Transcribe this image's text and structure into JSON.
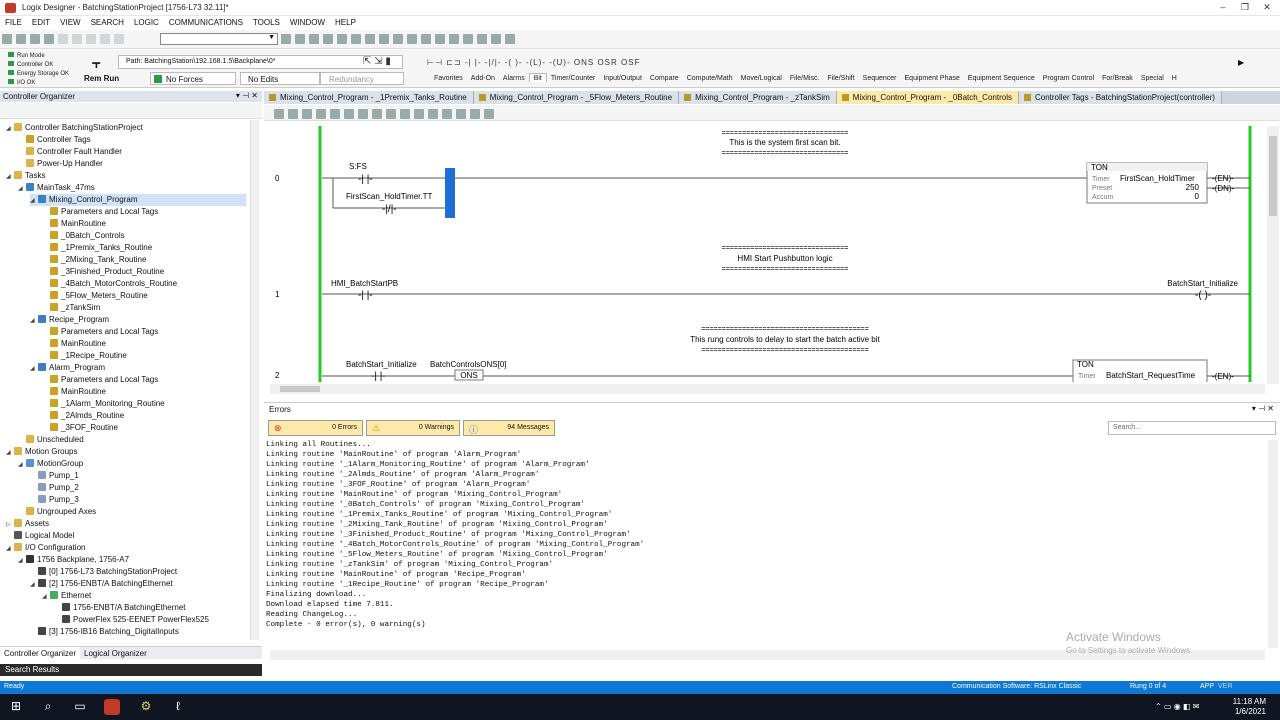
{
  "window": {
    "title": "Logix Designer - BatchingStationProject [1756-L73 32.11]*"
  },
  "menu": [
    "FILE",
    "EDIT",
    "VIEW",
    "SEARCH",
    "LOGIC",
    "COMMUNICATIONS",
    "TOOLS",
    "WINDOW",
    "HELP"
  ],
  "status": {
    "run_mode": "Run Mode",
    "controller_ok": "Controller OK",
    "energy_storage_ok": "Energy Storage OK",
    "io_ok": "I/O OK",
    "rem_run": "Rem Run",
    "no_forces": "No Forces",
    "no_edits": "No Edits",
    "redundancy": "Redundancy"
  },
  "path": {
    "label": "Path: BatchingStation\\192.168.1.5\\Backplane\\0*"
  },
  "instructions": [
    "ONS",
    "OSR",
    "OSF"
  ],
  "categories": [
    "Favorites",
    "Add-On",
    "Alarms",
    "Bit",
    "Timer/Counter",
    "Input/Output",
    "Compare",
    "Compute/Math",
    "Move/Logical",
    "File/Misc.",
    "File/Shift",
    "Sequencer",
    "Equipment Phase",
    "Equipment Sequence",
    "Program Control",
    "For/Break",
    "Special",
    "H"
  ],
  "active_category": "Bit",
  "organizer": {
    "title": "Controller Organizer",
    "tabs": [
      "Controller Organizer",
      "Logical Organizer"
    ],
    "tree": [
      {
        "label": "Controller BatchingStationProject",
        "level": 0,
        "exp": "◢",
        "icon": "folder"
      },
      {
        "label": "Controller Tags",
        "level": 1,
        "exp": "",
        "icon": "tag"
      },
      {
        "label": "Controller Fault Handler",
        "level": 1,
        "exp": "",
        "icon": "folder"
      },
      {
        "label": "Power-Up Handler",
        "level": 1,
        "exp": "",
        "icon": "folder"
      },
      {
        "label": "Tasks",
        "level": 0,
        "exp": "◢",
        "icon": "folder"
      },
      {
        "label": "MainTask_47ms",
        "level": 1,
        "exp": "◢",
        "icon": "task"
      },
      {
        "label": "Mixing_Control_Program",
        "level": 2,
        "exp": "◢",
        "icon": "program",
        "selected": true
      },
      {
        "label": "Parameters and Local Tags",
        "level": 3,
        "exp": "",
        "icon": "tag"
      },
      {
        "label": "MainRoutine",
        "level": 3,
        "exp": "",
        "icon": "routine"
      },
      {
        "label": "_0Batch_Controls",
        "level": 3,
        "exp": "",
        "icon": "routine"
      },
      {
        "label": "_1Premix_Tanks_Routine",
        "level": 3,
        "exp": "",
        "icon": "routine"
      },
      {
        "label": "_2Mixing_Tank_Routine",
        "level": 3,
        "exp": "",
        "icon": "routine"
      },
      {
        "label": "_3Finished_Product_Routine",
        "level": 3,
        "exp": "",
        "icon": "routine"
      },
      {
        "label": "_4Batch_MotorControls_Routine",
        "level": 3,
        "exp": "",
        "icon": "routine"
      },
      {
        "label": "_5Flow_Meters_Routine",
        "level": 3,
        "exp": "",
        "icon": "routine"
      },
      {
        "label": "_zTankSim",
        "level": 3,
        "exp": "",
        "icon": "routine"
      },
      {
        "label": "Recipe_Program",
        "level": 2,
        "exp": "◢",
        "icon": "program"
      },
      {
        "label": "Parameters and Local Tags",
        "level": 3,
        "exp": "",
        "icon": "tag"
      },
      {
        "label": "MainRoutine",
        "level": 3,
        "exp": "",
        "icon": "routine"
      },
      {
        "label": "_1Recipe_Routine",
        "level": 3,
        "exp": "",
        "icon": "routine"
      },
      {
        "label": "Alarm_Program",
        "level": 2,
        "exp": "◢",
        "icon": "program"
      },
      {
        "label": "Parameters and Local Tags",
        "level": 3,
        "exp": "",
        "icon": "tag"
      },
      {
        "label": "MainRoutine",
        "level": 3,
        "exp": "",
        "icon": "routine"
      },
      {
        "label": "_1Alarm_Monitoring_Routine",
        "level": 3,
        "exp": "",
        "icon": "routine"
      },
      {
        "label": "_2Almds_Routine",
        "level": 3,
        "exp": "",
        "icon": "routine"
      },
      {
        "label": "_3FOF_Routine",
        "level": 3,
        "exp": "",
        "icon": "routine"
      },
      {
        "label": "Unscheduled",
        "level": 1,
        "exp": "",
        "icon": "folder"
      },
      {
        "label": "Motion Groups",
        "level": 0,
        "exp": "◢",
        "icon": "folder"
      },
      {
        "label": "MotionGroup",
        "level": 1,
        "exp": "◢",
        "icon": "motion"
      },
      {
        "label": "Pump_1",
        "level": 2,
        "exp": "",
        "icon": "axis"
      },
      {
        "label": "Pump_2",
        "level": 2,
        "exp": "",
        "icon": "axis"
      },
      {
        "label": "Pump_3",
        "level": 2,
        "exp": "",
        "icon": "axis"
      },
      {
        "label": "Ungrouped Axes",
        "level": 1,
        "exp": "",
        "icon": "folder"
      },
      {
        "label": "Assets",
        "level": 0,
        "exp": "▷",
        "icon": "folder"
      },
      {
        "label": "Logical Model",
        "level": 0,
        "exp": "",
        "icon": "model"
      },
      {
        "label": "I/O Configuration",
        "level": 0,
        "exp": "◢",
        "icon": "folder"
      },
      {
        "label": "1756 Backplane, 1756-A7",
        "level": 1,
        "exp": "◢",
        "icon": "chassis"
      },
      {
        "label": "[0] 1756-L73 BatchingStationProject",
        "level": 2,
        "exp": "",
        "icon": "module"
      },
      {
        "label": "[2] 1756-ENBT/A BatchingEthernet",
        "level": 2,
        "exp": "◢",
        "icon": "module"
      },
      {
        "label": "Ethernet",
        "level": 3,
        "exp": "◢",
        "icon": "network"
      },
      {
        "label": "1756-ENBT/A BatchingEthernet",
        "level": 4,
        "exp": "",
        "icon": "module"
      },
      {
        "label": "PowerFlex 525-EENET PowerFlex525",
        "level": 4,
        "exp": "",
        "icon": "module"
      },
      {
        "label": "[3] 1756-IB16 Batching_DigitalInputs",
        "level": 2,
        "exp": "",
        "icon": "module"
      }
    ]
  },
  "search_results": "Search Results",
  "doc_tabs": [
    {
      "label": "Mixing_Control_Program - _1Premix_Tanks_Routine",
      "active": false
    },
    {
      "label": "Mixing_Control_Program - _5Flow_Meters_Routine",
      "active": false
    },
    {
      "label": "Mixing_Control_Program - _zTankSim",
      "active": false
    },
    {
      "label": "Mixing_Control_Program - _0Batch_Controls",
      "active": true
    },
    {
      "label": "Controller Tags - BatchingStationProject(controller)",
      "active": false
    }
  ],
  "ladder": {
    "rung0": {
      "num": "0",
      "comment_sep": "===============================",
      "comment": "This is the system first scan bit.",
      "contact1": "S:FS",
      "contact2": "FirstScan_HoldTimer.TT",
      "ton": {
        "type": "TON",
        "timer_label": "Timer",
        "timer": "FirstScan_HoldTimer",
        "preset_label": "Preset",
        "preset": "250",
        "accum_label": "Accum",
        "accum": "0",
        "en": "EN",
        "dn": "DN"
      }
    },
    "rung1": {
      "num": "1",
      "comment_sep": "===============================",
      "comment": "HMI Start Pushbutton logic",
      "contact": "HMI_BatchStartPB",
      "coil": "BatchStart_Initialize"
    },
    "rung2": {
      "num": "2",
      "comment_sep": "=========================================",
      "comment": "This rung controls to delay to start the batch active bit",
      "contact": "BatchStart_Initialize",
      "ons_tag": "BatchControlsONS[0]",
      "ons": "ONS",
      "ton": {
        "type": "TON",
        "timer_label": "Timer",
        "timer": "BatchStart_RequestTime",
        "en": "EN"
      }
    }
  },
  "errors_panel": {
    "title": "Errors",
    "errors": "0 Errors",
    "warnings": "0 Warnings",
    "messages": "94 Messages",
    "search_placeholder": "Search...",
    "log": [
      "Linking all Routines...",
      "Linking routine 'MainRoutine' of program 'Alarm_Program'",
      "Linking routine '_1Alarm_Monitoring_Routine' of program 'Alarm_Program'",
      "Linking routine '_2Almds_Routine' of program 'Alarm_Program'",
      "Linking routine '_3FOF_Routine' of program 'Alarm_Program'",
      "Linking routine 'MainRoutine' of program 'Mixing_Control_Program'",
      "Linking routine '_0Batch_Controls' of program 'Mixing_Control_Program'",
      "Linking routine '_1Premix_Tanks_Routine' of program 'Mixing_Control_Program'",
      "Linking routine '_2Mixing_Tank_Routine' of program 'Mixing_Control_Program'",
      "Linking routine '_3Finished_Product_Routine' of program 'Mixing_Control_Program'",
      "Linking routine '_4Batch_MotorControls_Routine' of program 'Mixing_Control_Program'",
      "Linking routine '_5Flow_Meters_Routine' of program 'Mixing_Control_Program'",
      "Linking routine '_zTankSim' of program 'Mixing_Control_Program'",
      "Linking routine 'MainRoutine' of program 'Recipe_Program'",
      "Linking routine '_1Recipe_Routine' of program 'Recipe_Program'",
      "Finalizing download...",
      "Download elapsed time 7.811.",
      "Reading ChangeLog...",
      "Complete - 0 error(s), 0 warning(s)"
    ]
  },
  "watermark": {
    "line1": "Activate Windows",
    "line2": "Go to Settings to activate Windows."
  },
  "statusbar": {
    "ready": "Ready",
    "comm": "Communication Software: RSLinx Classic",
    "rung": "Rung 0 of 4",
    "app": "APP",
    "ver": "VER"
  },
  "taskbar": {
    "time": "11:18 AM",
    "date": "1/6/2021"
  },
  "colors": {
    "accent": "#0e78d4",
    "rail": "#22cc22",
    "active_tab": "#ffe9a8",
    "ons_blue": "#1d6fd6"
  }
}
